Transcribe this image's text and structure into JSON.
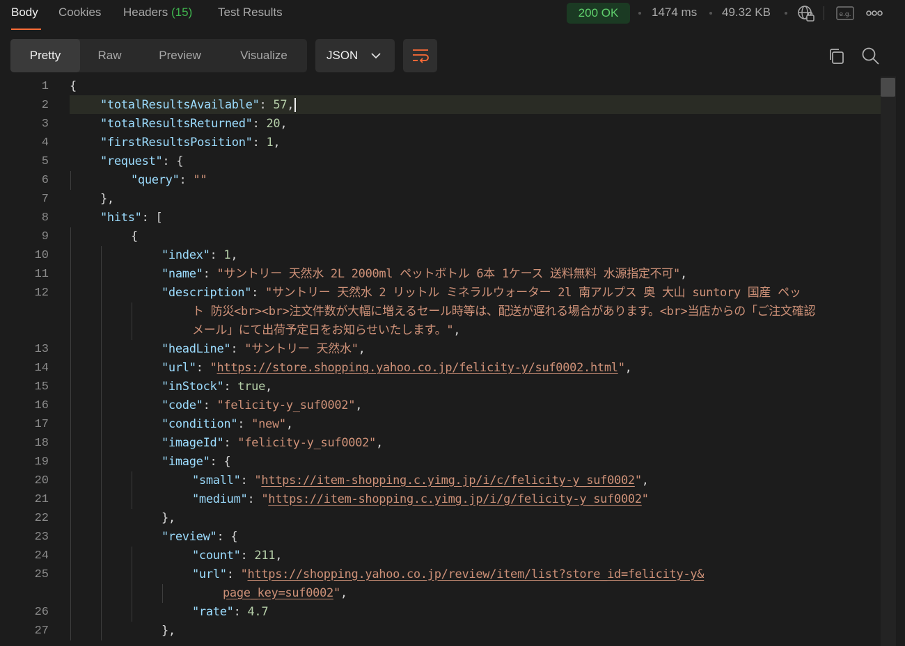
{
  "tabs": [
    {
      "label": "Body",
      "active": true
    },
    {
      "label": "Cookies",
      "active": false
    },
    {
      "label": "Headers",
      "count": "(15)",
      "active": false
    },
    {
      "label": "Test Results",
      "active": false
    }
  ],
  "status": {
    "code": "200 OK",
    "time": "1474 ms",
    "size": "49.32 KB"
  },
  "toolbar": {
    "views": [
      "Pretty",
      "Raw",
      "Preview",
      "Visualize"
    ],
    "active_view": "Pretty",
    "format": "JSON"
  },
  "colors": {
    "accent": "#ff6c37",
    "status_ok": "#5fcf6c",
    "key": "#9cdcfe",
    "string": "#ce9178",
    "number": "#b5cea8"
  },
  "icons": [
    "globe-lock-icon",
    "example-icon",
    "more-icon",
    "chevron-down-icon",
    "wrap-lines-icon",
    "copy-icon",
    "search-icon"
  ],
  "code": {
    "lines": [
      {
        "n": "1",
        "indent": 0,
        "parts": [
          [
            "p",
            "{"
          ]
        ]
      },
      {
        "n": "2",
        "indent": 1,
        "parts": [
          [
            "k",
            "\"totalResultsAvailable\""
          ],
          [
            "p",
            ": "
          ],
          [
            "n",
            "57"
          ],
          [
            "p",
            ","
          ]
        ],
        "cursor": true
      },
      {
        "n": "3",
        "indent": 1,
        "parts": [
          [
            "k",
            "\"totalResultsReturned\""
          ],
          [
            "p",
            ": "
          ],
          [
            "n",
            "20"
          ],
          [
            "p",
            ","
          ]
        ]
      },
      {
        "n": "4",
        "indent": 1,
        "parts": [
          [
            "k",
            "\"firstResultsPosition\""
          ],
          [
            "p",
            ": "
          ],
          [
            "n",
            "1"
          ],
          [
            "p",
            ","
          ]
        ]
      },
      {
        "n": "5",
        "indent": 1,
        "parts": [
          [
            "k",
            "\"request\""
          ],
          [
            "p",
            ": {"
          ]
        ]
      },
      {
        "n": "6",
        "indent": 2,
        "parts": [
          [
            "k",
            "\"query\""
          ],
          [
            "p",
            ": "
          ],
          [
            "s",
            "\"\""
          ]
        ]
      },
      {
        "n": "7",
        "indent": 1,
        "parts": [
          [
            "p",
            "},"
          ]
        ]
      },
      {
        "n": "8",
        "indent": 1,
        "parts": [
          [
            "k",
            "\"hits\""
          ],
          [
            "p",
            ": ["
          ]
        ]
      },
      {
        "n": "9",
        "indent": 2,
        "parts": [
          [
            "p",
            "{"
          ]
        ]
      },
      {
        "n": "10",
        "indent": 3,
        "parts": [
          [
            "k",
            "\"index\""
          ],
          [
            "p",
            ": "
          ],
          [
            "n",
            "1"
          ],
          [
            "p",
            ","
          ]
        ]
      },
      {
        "n": "11",
        "indent": 3,
        "parts": [
          [
            "k",
            "\"name\""
          ],
          [
            "p",
            ": "
          ],
          [
            "s",
            "\"サントリー 天然水 2L 2000ml ペットボトル 6本 1ケース 送料無料 水源指定不可\""
          ],
          [
            "p",
            ","
          ]
        ]
      },
      {
        "n": "12",
        "indent": 3,
        "parts": [
          [
            "k",
            "\"description\""
          ],
          [
            "p",
            ": "
          ],
          [
            "s",
            "\"サントリー 天然水 2 リットル ミネラルウォーター 2l 南アルプス 奥 大山 suntory 国産 ペッ"
          ]
        ]
      },
      {
        "n": "",
        "indent": 4,
        "parts": [
          [
            "s",
            "ト 防災<br><br>注文件数が大幅に増えるセール時等は、配送が遅れる場合があります。<br>当店からの「ご注文確認"
          ]
        ]
      },
      {
        "n": "",
        "indent": 4,
        "parts": [
          [
            "s",
            "メール」にて出荷予定日をお知らせいたします。\""
          ],
          [
            "p",
            ","
          ]
        ]
      },
      {
        "n": "13",
        "indent": 3,
        "parts": [
          [
            "k",
            "\"headLine\""
          ],
          [
            "p",
            ": "
          ],
          [
            "s",
            "\"サントリー 天然水\""
          ],
          [
            "p",
            ","
          ]
        ]
      },
      {
        "n": "14",
        "indent": 3,
        "parts": [
          [
            "k",
            "\"url\""
          ],
          [
            "p",
            ": "
          ],
          [
            "s",
            "\""
          ],
          [
            "u",
            "https://store.shopping.yahoo.co.jp/felicity-y/suf0002.html"
          ],
          [
            "s",
            "\""
          ],
          [
            "p",
            ","
          ]
        ]
      },
      {
        "n": "15",
        "indent": 3,
        "parts": [
          [
            "k",
            "\"inStock\""
          ],
          [
            "p",
            ": "
          ],
          [
            "n",
            "true"
          ],
          [
            "p",
            ","
          ]
        ]
      },
      {
        "n": "16",
        "indent": 3,
        "parts": [
          [
            "k",
            "\"code\""
          ],
          [
            "p",
            ": "
          ],
          [
            "s",
            "\"felicity-y_suf0002\""
          ],
          [
            "p",
            ","
          ]
        ]
      },
      {
        "n": "17",
        "indent": 3,
        "parts": [
          [
            "k",
            "\"condition\""
          ],
          [
            "p",
            ": "
          ],
          [
            "s",
            "\"new\""
          ],
          [
            "p",
            ","
          ]
        ]
      },
      {
        "n": "18",
        "indent": 3,
        "parts": [
          [
            "k",
            "\"imageId\""
          ],
          [
            "p",
            ": "
          ],
          [
            "s",
            "\"felicity-y_suf0002\""
          ],
          [
            "p",
            ","
          ]
        ]
      },
      {
        "n": "19",
        "indent": 3,
        "parts": [
          [
            "k",
            "\"image\""
          ],
          [
            "p",
            ": {"
          ]
        ]
      },
      {
        "n": "20",
        "indent": 4,
        "parts": [
          [
            "k",
            "\"small\""
          ],
          [
            "p",
            ": "
          ],
          [
            "s",
            "\""
          ],
          [
            "u",
            "https://item-shopping.c.yimg.jp/i/c/felicity-y_suf0002"
          ],
          [
            "s",
            "\""
          ],
          [
            "p",
            ","
          ]
        ]
      },
      {
        "n": "21",
        "indent": 4,
        "parts": [
          [
            "k",
            "\"medium\""
          ],
          [
            "p",
            ": "
          ],
          [
            "s",
            "\""
          ],
          [
            "u",
            "https://item-shopping.c.yimg.jp/i/g/felicity-y_suf0002"
          ],
          [
            "s",
            "\""
          ]
        ]
      },
      {
        "n": "22",
        "indent": 3,
        "parts": [
          [
            "p",
            "},"
          ]
        ]
      },
      {
        "n": "23",
        "indent": 3,
        "parts": [
          [
            "k",
            "\"review\""
          ],
          [
            "p",
            ": {"
          ]
        ]
      },
      {
        "n": "24",
        "indent": 4,
        "parts": [
          [
            "k",
            "\"count\""
          ],
          [
            "p",
            ": "
          ],
          [
            "n",
            "211"
          ],
          [
            "p",
            ","
          ]
        ]
      },
      {
        "n": "25",
        "indent": 4,
        "parts": [
          [
            "k",
            "\"url\""
          ],
          [
            "p",
            ": "
          ],
          [
            "s",
            "\""
          ],
          [
            "u",
            "https://shopping.yahoo.co.jp/review/item/list?store_id=felicity-y&"
          ]
        ]
      },
      {
        "n": "",
        "indent": 5,
        "parts": [
          [
            "u",
            "page_key=suf0002"
          ],
          [
            "s",
            "\""
          ],
          [
            "p",
            ","
          ]
        ]
      },
      {
        "n": "26",
        "indent": 4,
        "parts": [
          [
            "k",
            "\"rate\""
          ],
          [
            "p",
            ": "
          ],
          [
            "n",
            "4.7"
          ]
        ]
      },
      {
        "n": "27",
        "indent": 3,
        "parts": [
          [
            "p",
            "},"
          ]
        ]
      }
    ]
  }
}
